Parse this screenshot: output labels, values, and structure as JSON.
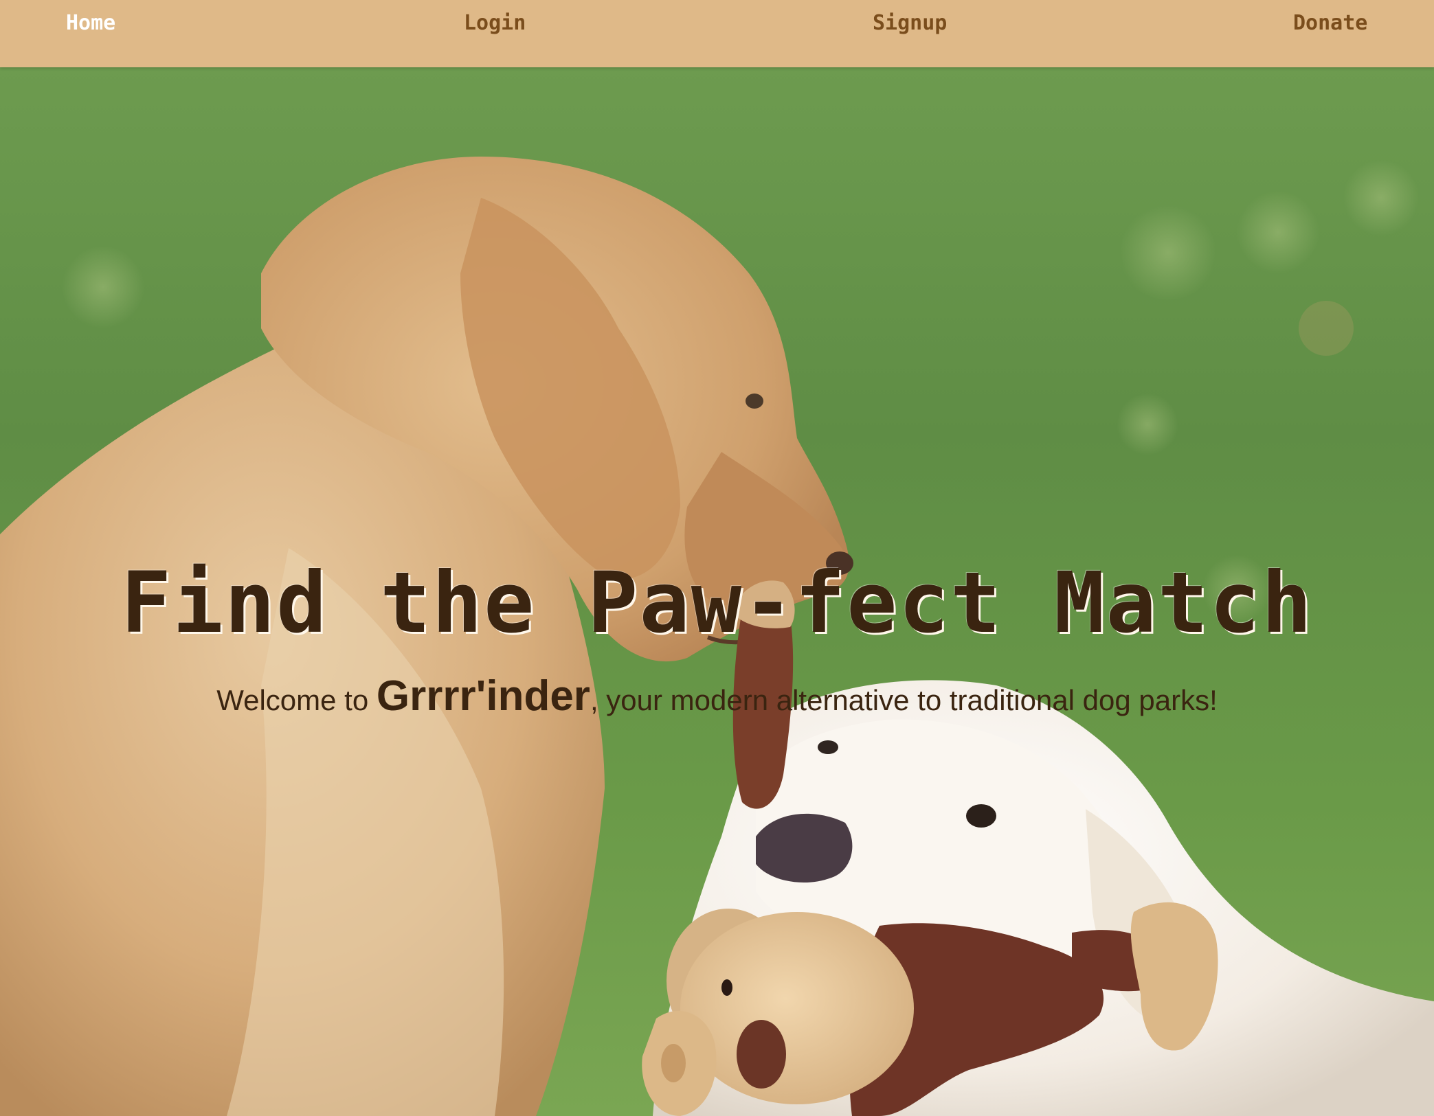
{
  "nav": {
    "items": [
      {
        "label": "Home",
        "active": true
      },
      {
        "label": "Login",
        "active": false
      },
      {
        "label": "Signup",
        "active": false
      },
      {
        "label": "Donate",
        "active": false
      }
    ]
  },
  "hero": {
    "title": "Find the Paw-fect Match",
    "subtitle_prefix": "Welcome to ",
    "brand": "Grrrr'inder",
    "subtitle_suffix": ", your modern alternative to traditional dog parks!"
  },
  "colors": {
    "navbar": "#dfb988",
    "nav_link": "#7a4d1c",
    "nav_active": "#ffffff",
    "text": "#3a2410",
    "grass": "#6f9a4e"
  }
}
